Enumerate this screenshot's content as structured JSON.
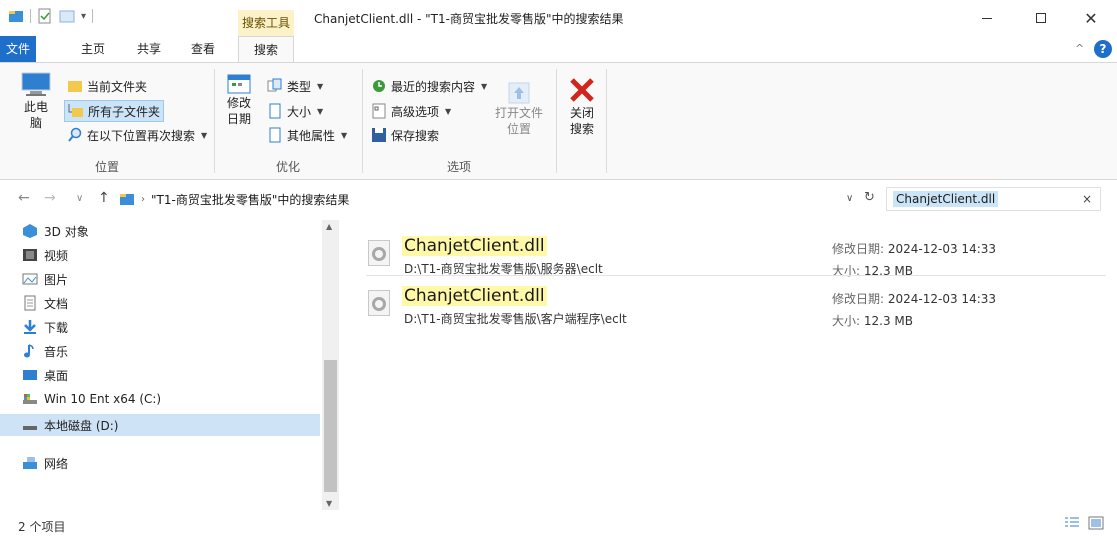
{
  "window": {
    "context_tab": "搜索工具",
    "title": "ChanjetClient.dll - \"T1-商贸宝批发零售版\"中的搜索结果",
    "controls": {
      "minimize": "—",
      "maximize": "☐",
      "close": "✕"
    }
  },
  "ribbon_tabs": [
    "文件",
    "主页",
    "共享",
    "查看",
    "搜索"
  ],
  "ribbon": {
    "location": {
      "label": "位置",
      "this_pc": "此电脑",
      "current_folder": "当前文件夹",
      "all_subfolders": "所有子文件夹",
      "search_again": "在以下位置再次搜索"
    },
    "refine": {
      "label": "优化",
      "date_modified": "修改日期",
      "kind": "类型",
      "size": "大小",
      "other_properties": "其他属性"
    },
    "options": {
      "label": "选项",
      "recent_searches": "最近的搜索内容",
      "advanced_options": "高级选项",
      "save_search": "保存搜索",
      "open_file_location": "打开文件位置"
    },
    "close": {
      "label": "关闭搜索"
    }
  },
  "address_bar": {
    "path": "\"T1-商贸宝批发零售版\"中的搜索结果"
  },
  "search": {
    "query": "ChanjetClient.dll"
  },
  "nav_pane": [
    {
      "label": "3D 对象",
      "icon": "3d-objects-icon"
    },
    {
      "label": "视频",
      "icon": "video-icon"
    },
    {
      "label": "图片",
      "icon": "pictures-icon"
    },
    {
      "label": "文档",
      "icon": "documents-icon"
    },
    {
      "label": "下载",
      "icon": "downloads-icon"
    },
    {
      "label": "音乐",
      "icon": "music-icon"
    },
    {
      "label": "桌面",
      "icon": "desktop-icon"
    },
    {
      "label": "Win 10 Ent x64 (C:)",
      "icon": "drive-c-icon"
    },
    {
      "label": "本地磁盘 (D:)",
      "icon": "drive-d-icon",
      "selected": true
    },
    {
      "label": "网络",
      "icon": "network-icon"
    }
  ],
  "results": [
    {
      "name": "ChanjetClient.dll",
      "path": "D:\\T1-商贸宝批发零售版\\服务器\\eclt",
      "modified_label": "修改日期:",
      "modified": "2024-12-03 14:33",
      "size_label": "大小:",
      "size": "12.3 MB"
    },
    {
      "name": "ChanjetClient.dll",
      "path": "D:\\T1-商贸宝批发零售版\\客户端程序\\eclt",
      "modified_label": "修改日期:",
      "modified": "2024-12-03 14:33",
      "size_label": "大小:",
      "size": "12.3 MB"
    }
  ],
  "status": {
    "item_count": "2 个项目"
  },
  "colors": {
    "accent": "#1e6fc9",
    "highlight": "#fff8a6",
    "selection": "#cfe3f6",
    "context_tab": "#fbf2c9"
  }
}
